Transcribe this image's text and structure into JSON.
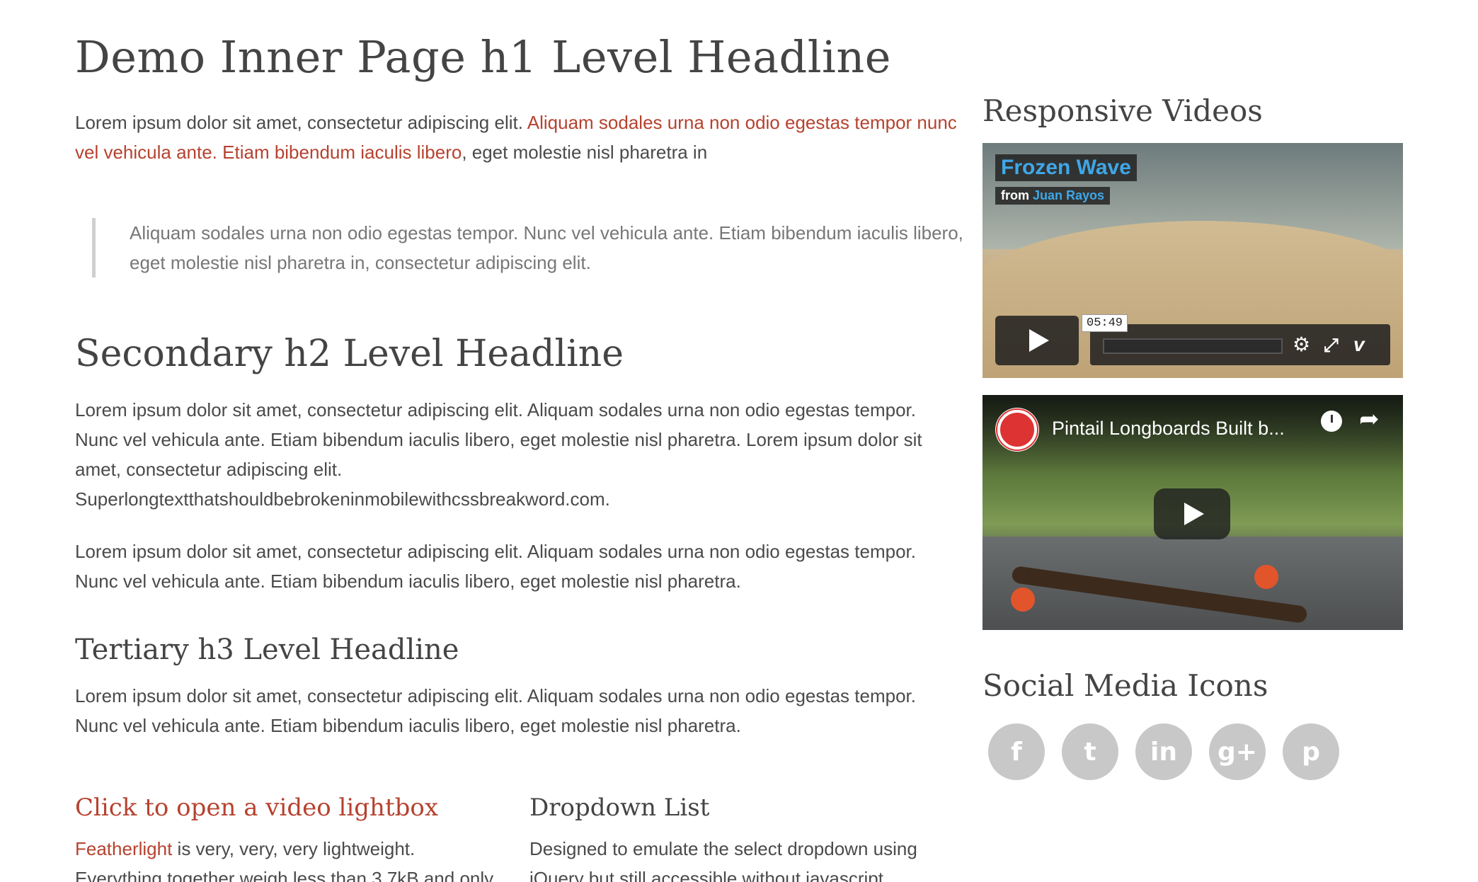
{
  "main": {
    "title": "Demo Inner Page h1 Level Headline",
    "intro": {
      "text1": "Lorem ipsum dolor sit amet, consectetur adipiscing elit. ",
      "link1": "Aliquam sodales urna non odio egestas tempor nunc vel vehicula ante.",
      "space": " ",
      "link2": "Etiam bibendum iaculis libero",
      "text2": ", eget molestie nisl pharetra in"
    },
    "blockquote": "Aliquam sodales urna non odio egestas tempor. Nunc vel vehicula ante. Etiam bibendum iaculis libero, eget molestie nisl pharetra in, consectetur adipiscing elit.",
    "h2": "Secondary h2 Level Headline",
    "para2": "Lorem ipsum dolor sit amet, consectetur adipiscing elit. Aliquam sodales urna non odio egestas tempor. Nunc vel vehicula ante. Etiam bibendum iaculis libero, eget molestie nisl pharetra. Lorem ipsum dolor sit amet, consectetur adipiscing elit.",
    "para2_long": "Superlongtextthatshouldbebrokeninmobilewithcssbreakword.com.",
    "para3": "Lorem ipsum dolor sit amet, consectetur adipiscing elit. Aliquam sodales urna non odio egestas tempor. Nunc vel vehicula ante. Etiam bibendum iaculis libero, eget molestie nisl pharetra.",
    "h3": "Tertiary h3 Level Headline",
    "para4": "Lorem ipsum dolor sit amet, consectetur adipiscing elit. Aliquam sodales urna non odio egestas tempor. Nunc vel vehicula ante. Etiam bibendum iaculis libero, eget molestie nisl pharetra.",
    "lightbox": {
      "heading": "Click to open a video lightbox",
      "link": "Featherlight",
      "text": " is very, very, very lightweight. Everything together weigh less than 3.7kB and only counts about 150 lines of JavaScript code. To"
    },
    "dropdown": {
      "heading": "Dropdown List",
      "text": "Designed to emulate the select dropdown using jQuery but still accessible without javascript."
    }
  },
  "sidebar": {
    "videos_heading": "Responsive Videos",
    "video1": {
      "title": "Frozen Wave",
      "from_label": "from ",
      "author": "Juan Rayos",
      "time": "05:49",
      "vimeo_mark": "v"
    },
    "video2": {
      "title": "Pintail Longboards Built b..."
    },
    "social_heading": "Social Media Icons",
    "social": [
      {
        "name": "facebook",
        "glyph": "f"
      },
      {
        "name": "twitter",
        "glyph": "t"
      },
      {
        "name": "linkedin",
        "glyph": "in"
      },
      {
        "name": "google-plus",
        "glyph": "g+"
      },
      {
        "name": "pinterest",
        "glyph": "p"
      }
    ]
  }
}
